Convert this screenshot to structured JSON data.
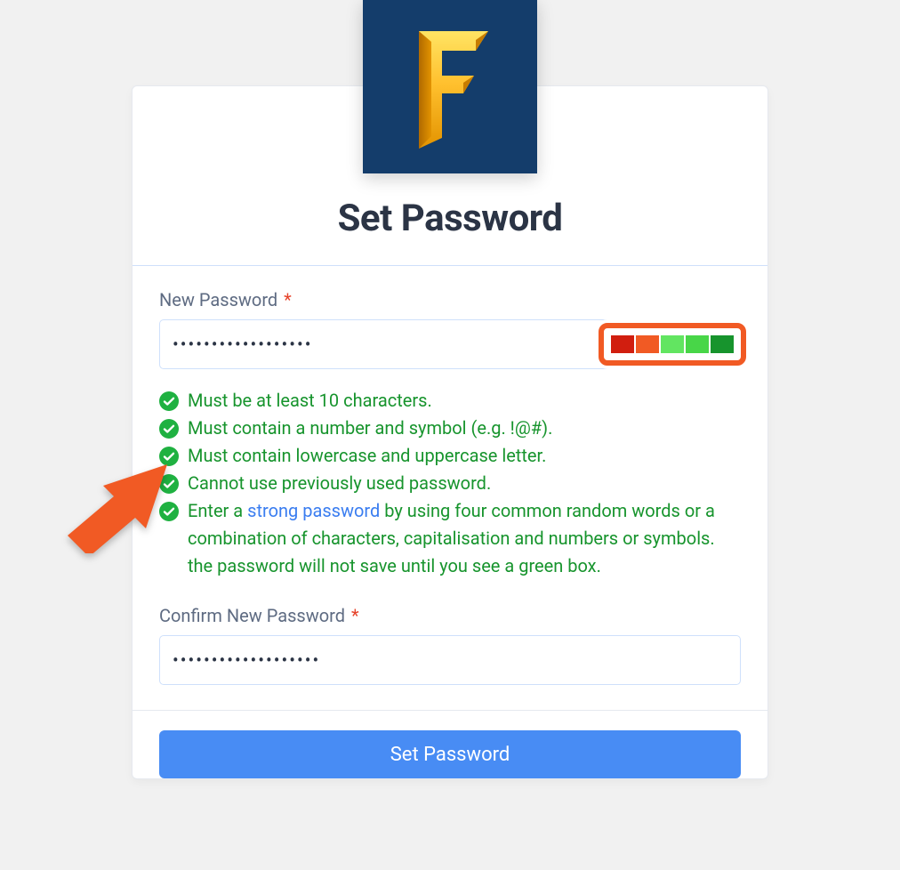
{
  "page_title": "Set Password",
  "logo_letter": "F",
  "colors": {
    "green_text": "#17942d",
    "link": "#3a7df0",
    "button_bg": "#488cf4",
    "highlight_border": "#f15a24",
    "arrow": "#f15a24"
  },
  "fields": {
    "new_password": {
      "label": "New Password",
      "required_marker": "*",
      "value": "••••••••••••••••••"
    },
    "confirm_password": {
      "label": "Confirm New Password",
      "required_marker": "*",
      "value": "•••••••••••••••••••"
    }
  },
  "strength": {
    "segments": [
      "#d11e0f",
      "#f15a24",
      "#62e561",
      "#48d648",
      "#17942d"
    ]
  },
  "requirements": [
    {
      "met": true,
      "text": "Must be at least 10 characters."
    },
    {
      "met": true,
      "text": "Must contain a number and symbol (e.g. !@#)."
    },
    {
      "met": true,
      "text": "Must contain lowercase and uppercase letter."
    },
    {
      "met": true,
      "text": "Cannot use previously used password."
    },
    {
      "met": true,
      "prefix": "Enter a ",
      "link_text": "strong password",
      "suffix": " by using four common random words or a combination of characters, capitalisation and numbers or symbols. the password will not save until you see a green box."
    }
  ],
  "submit_label": "Set Password"
}
